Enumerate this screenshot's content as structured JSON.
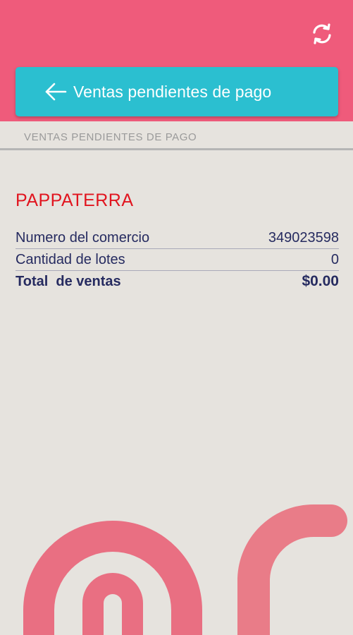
{
  "header": {
    "title": "Ventas pendientes de pago",
    "back_icon": "arrow-left-icon",
    "refresh_icon": "refresh-icon"
  },
  "section": {
    "label": "VENTAS PENDIENTES DE PAGO"
  },
  "merchant": {
    "name": "PAPPATERRA",
    "rows": [
      {
        "label": "Numero del comercio",
        "value": "349023598"
      },
      {
        "label": "Cantidad de lotes",
        "value": "0"
      }
    ],
    "total": {
      "label": "Total  de ventas",
      "value": "$0.00"
    }
  },
  "colors": {
    "brand_pink": "#ef5b7b",
    "header_teal": "#2bbfd0",
    "merchant_red": "#e1151f",
    "text_navy": "#262b60",
    "background": "#e6e3de"
  }
}
